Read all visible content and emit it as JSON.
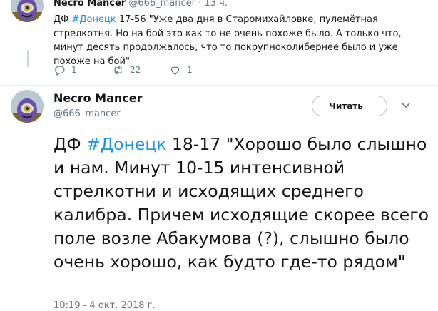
{
  "reply_tweet": {
    "author_name": "Necro Mancer",
    "author_handle": "@666_mancer",
    "separator": "·",
    "time": "13 ч.",
    "text_prefix": "ДФ ",
    "hashtag": "#Донецк",
    "text_body": " 17-56 \"Уже два дня в Старомихайловке, пулемётная стрелкотня. Но на бой  это как то не очень похоже было. А только что, минут десять продолжалось, что то покрупноколибернее было и уже похоже на бой\"",
    "actions": {
      "reply_icon": "reply-icon",
      "reply_count": "1",
      "retweet_icon": "retweet-icon",
      "retweet_count": "22",
      "like_icon": "heart-icon",
      "like_count": "1"
    }
  },
  "main_tweet": {
    "author_name": "Necro Mancer",
    "author_handle": "@666_mancer",
    "follow_label": "Читать",
    "menu_icon": "chevron-down-icon",
    "text_prefix": "ДФ ",
    "hashtag": "#Донецк",
    "text_body": " 18-17 \"Хорошо было слышно и нам. Минут 10-15 интенсивной стрелкотни и  исходящих среднего калибра. Причем исходящие скорее всего поле возле  Абакумова (?), слышно было очень хорошо, как будто где-то рядом\"",
    "timestamp": "10:19 - 4 окт. 2018 г."
  },
  "colors": {
    "link": "#1b95e0",
    "secondary_text": "#657786",
    "primary_text": "#14171a",
    "divider": "#e6ecf0"
  }
}
